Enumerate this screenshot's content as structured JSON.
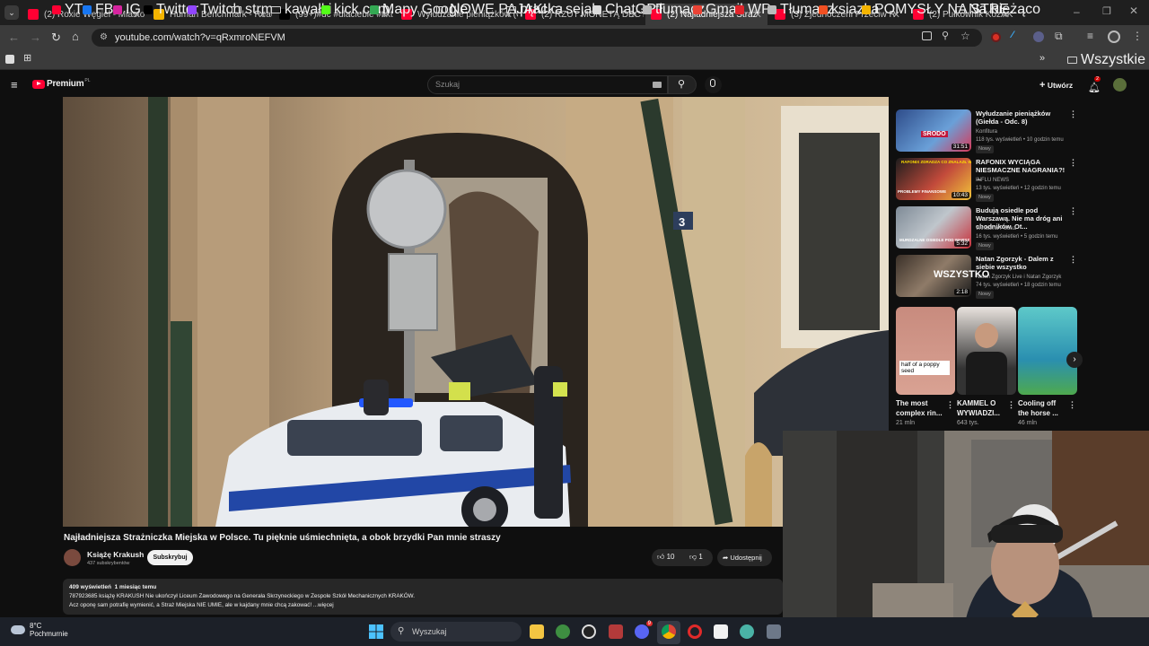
{
  "browser": {
    "tabs": [
      {
        "title": "(2) Roxie Węgiel - Miasto",
        "color": "#ff0033"
      },
      {
        "title": "Human Benchmark - Reac",
        "color": "#f4b400"
      },
      {
        "title": "(99+)#dc #dlaciebie #tikt",
        "color": "#000000"
      },
      {
        "title": "Wyłudzanie pieniążków (G",
        "color": "#ff0033"
      },
      {
        "title": "(2) RZUT MONETĄ DECYD",
        "color": "#ff0033"
      },
      {
        "title": "(2) Najładniejsza Straż",
        "color": "#ff0033",
        "active": true
      },
      {
        "title": "(3) Zjednoczeni Przeciw R",
        "color": "#ff0033"
      },
      {
        "title": "(2) Pułkownik KozAK z of",
        "color": "#ff0033"
      }
    ],
    "url": "youtube.com/watch?v=qRxmroNEFVM",
    "bookmarks": [
      {
        "label": "YT",
        "icon": "youtube-icon"
      },
      {
        "label": "FB",
        "icon": "facebook-icon"
      },
      {
        "label": "IG",
        "icon": "instagram-icon"
      },
      {
        "label": "Twitter",
        "icon": "x-icon"
      },
      {
        "label": "Twitch",
        "icon": "twitch-icon"
      },
      {
        "label": "strm",
        "icon": "folder-icon"
      },
      {
        "label": "kawałki",
        "icon": "folder-icon"
      },
      {
        "label": "kick.com",
        "icon": "kick-icon"
      },
      {
        "label": "Mapy Google",
        "icon": "maps-icon"
      },
      {
        "label": "NOWE PAJĄKI",
        "icon": "folder-icon"
      },
      {
        "label": "pracka",
        "icon": "folder-icon"
      },
      {
        "label": "sejak",
        "icon": "folder-icon"
      },
      {
        "label": "ChatGPT",
        "icon": "chatgpt-icon"
      },
      {
        "label": "tłumacz",
        "icon": "translate-icon"
      },
      {
        "label": "Gmail",
        "icon": "gmail-icon"
      },
      {
        "label": "WP",
        "icon": "wp-icon"
      },
      {
        "label": "Tłumacz",
        "icon": "translate-icon"
      },
      {
        "label": "ksiazka",
        "icon": "windows-icon"
      },
      {
        "label": "POMYSŁY NA STRE...",
        "icon": "bookmark-icon"
      },
      {
        "label": "Na bieżąco",
        "icon": "folder-icon"
      }
    ],
    "all_bookmarks": "Wszystkie zakładki"
  },
  "youtube": {
    "logo": "Premium",
    "logo_sup": "PL",
    "search_placeholder": "Szukaj",
    "create_label": "Utwórz",
    "notif_count": "2",
    "video": {
      "title": "Najładniejsza Strażniczka Miejska w Polsce. Tu pięknie uśmiechnięta, a obok brzydki Pan mnie straszy",
      "channel": "Książę Krakush",
      "subs": "437 subskrybentów",
      "subscribe": "Subskrybuj",
      "likes": "10",
      "dislikes": "1",
      "share": "Udostępnij",
      "views_line": "409 wyświetleń  1 miesiąc temu",
      "desc1": "787923685 książę KRAKUSH Nie ukończył Liceum Zawodowego na Generała Skrzyneckiego w Zespole Szkół Mechanicznych KRAKÓW.",
      "desc2": "Acz oponę sam potrafię wymienić, a Straż Miejska NIE UMIE, ale w kajdany mnie chcą zakować! ...więcej"
    },
    "recommendations": [
      {
        "title": "Wyłudzanie pieniążków (Giełda - Odc. 8)",
        "channel": "Konfitura",
        "meta": "118 tys. wyświetleń • 10 godzin temu",
        "badge": "Nowy",
        "duration": "31:51"
      },
      {
        "title": "RAFONIX WYCIĄGA NIESMACZNE NAGRANIA?! ...",
        "channel": "INFLU NEWS",
        "meta": "13 tys. wyświetleń • 12 godzin temu",
        "badge": "Nowy",
        "duration": "10:43"
      },
      {
        "title": "Budują osiedle pod Warszawą. Nie ma dróg ani chodników. Ot...",
        "channel": "Wirtualna Polska",
        "meta": "16 tys. wyświetleń • 5 godzin temu",
        "badge": "Nowy",
        "duration": "5:32"
      },
      {
        "title": "Natan Zgorzyk - Dalem z siebie wszystko",
        "channel": "Natan Zgorzyk Live i Natan Zgorzyk",
        "meta": "74 tys. wyświetleń • 18 godzin temu",
        "badge": "Nowy",
        "duration": "2:18"
      }
    ],
    "thumb_texts": [
      "SRODO",
      "RAFONIX ZDRADZA CO ZNALAZŁ W NAGRANIU",
      "PROBLEMY FINANSOWE",
      "MURDZALNE OSIEDLE POD WARSZAWĄ",
      "WSZYSTKO"
    ],
    "shorts": [
      {
        "title": "The most complex rin...",
        "views": "21 mln",
        "overlay": "half of a poppy seed"
      },
      {
        "title": "KAMMEL O WYWIADZI...",
        "views": "643 tys.",
        "overlay": ""
      },
      {
        "title": "Cooling off the horse ...",
        "views": "46 mln",
        "overlay": ""
      }
    ],
    "video_sign": "3"
  },
  "taskbar": {
    "weather_temp": "8°C",
    "weather_desc": "Pochmurnie",
    "search": "Wyszukaj",
    "discord_badge": "9"
  }
}
